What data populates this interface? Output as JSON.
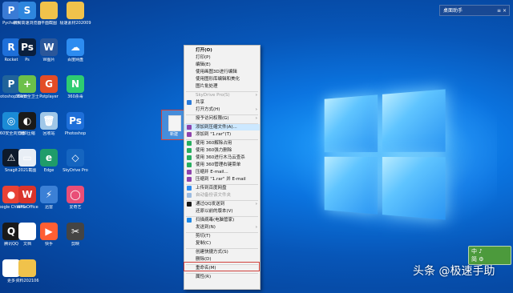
{
  "desktop_icons": [
    {
      "name": "shortcut-1",
      "label": "Pycharm",
      "color": "#3a7bd5",
      "glyph": "P"
    },
    {
      "name": "search-app",
      "label": "搜狗高速浏览器",
      "color": "#2e86de",
      "glyph": "S"
    },
    {
      "name": "folder-1",
      "label": "平面截图",
      "color": "#f0c24b",
      "glyph": ""
    },
    {
      "name": "folder-2",
      "label": "极速素材202009",
      "color": "#f0c24b",
      "glyph": ""
    },
    {
      "name": "shortcut-2",
      "label": "Rocket",
      "color": "#1e6fd9",
      "glyph": "R"
    },
    {
      "name": "photoshop",
      "label": "Ps",
      "color": "#0a1f3d",
      "glyph": "Ps"
    },
    {
      "name": "word",
      "label": "W图片",
      "color": "#2b579a",
      "glyph": "W"
    },
    {
      "name": "baidu-netdisk",
      "label": "百度网盘",
      "color": "#2d8cf0",
      "glyph": "☁"
    },
    {
      "name": "shortcut-3",
      "label": "Photoshop Elements",
      "color": "#20639b",
      "glyph": "P"
    },
    {
      "name": "shortcut-4",
      "label": "360安全卫士",
      "color": "#6cc04a",
      "glyph": "+"
    },
    {
      "name": "shortcut-5",
      "label": "Potplayer",
      "color": "#e34c26",
      "glyph": "G"
    },
    {
      "name": "shortcut-6",
      "label": "360杀毒",
      "color": "#2ecc71",
      "glyph": "N"
    },
    {
      "name": "shortcut-7",
      "label": "360安全浏览器",
      "color": "#1b8bd6",
      "glyph": "◎"
    },
    {
      "name": "shortcut-8",
      "label": "360压缩",
      "color": "#1a1a1a",
      "glyph": "◐"
    },
    {
      "name": "recycle-bin",
      "label": "回收站",
      "color": "#9fc7e8",
      "glyph": "🗑"
    },
    {
      "name": "shortcut-9",
      "label": "Photoshop",
      "color": "#1e6fd9",
      "glyph": "Ps"
    },
    {
      "name": "shortcut-10",
      "label": "Snagit",
      "color": "#0e1a2b",
      "glyph": "⚠"
    },
    {
      "name": "shortcut-11",
      "label": "2021截图",
      "color": "#e8eef5",
      "glyph": "▭"
    },
    {
      "name": "shortcut-12",
      "label": "Edge",
      "color": "#1f9c6a",
      "glyph": "e"
    },
    {
      "name": "shortcut-13",
      "label": "SkyDrive Pro",
      "color": "#1565c0",
      "glyph": "◇"
    },
    {
      "name": "shortcut-14",
      "label": "Google Chrome",
      "color": "#e94235",
      "glyph": "●"
    },
    {
      "name": "shortcut-15",
      "label": "WPS Office",
      "color": "#d9342b",
      "glyph": "W"
    },
    {
      "name": "shortcut-16",
      "label": "迅雷",
      "color": "#3b80d6",
      "glyph": "⚡"
    },
    {
      "name": "shortcut-17",
      "label": "爱奇艺",
      "color": "#e94e77",
      "glyph": "◯"
    },
    {
      "name": "shortcut-18",
      "label": "腾讯QQ",
      "color": "#1a1a1a",
      "glyph": "Q"
    },
    {
      "name": "shortcut-19",
      "label": "文档",
      "color": "#ffffff",
      "glyph": "▤"
    },
    {
      "name": "shortcut-20",
      "label": "快手",
      "color": "#ff5f33",
      "glyph": "▶"
    },
    {
      "name": "shortcut-21",
      "label": "剪映",
      "color": "#444",
      "glyph": "✂"
    },
    {
      "name": "shortcut-22",
      "label": "更多",
      "color": "#ffffff",
      "glyph": "▤"
    },
    {
      "name": "shortcut-23",
      "label": "资料202106",
      "color": "#f0c24b",
      "glyph": ""
    }
  ],
  "selected_file": {
    "label": "新建"
  },
  "context_menu": {
    "items": [
      {
        "label": "打开(O)",
        "bold": true
      },
      {
        "label": "打印(P)"
      },
      {
        "label": "编辑(E)"
      },
      {
        "label": "使用画图3D进行编辑"
      },
      {
        "label": "使用图形库编辑和美化"
      },
      {
        "label": "图片批处理"
      },
      {
        "label": "SkyDrive Pro(S)",
        "disabled": true,
        "submenu": true
      },
      {
        "label": "共享",
        "icon": "#2a7ad8"
      },
      {
        "label": "打开方式(H)",
        "submenu": true
      },
      {
        "label": "授予访问权限(G)",
        "submenu": true
      },
      {
        "label": "添加到压缩文件(A)...",
        "icon": "#8e44ad",
        "highlight": true
      },
      {
        "label": "添加到 \"1.rar\"(T)",
        "icon": "#8e44ad"
      },
      {
        "label": "使用 360解除占用",
        "icon": "#27ae60"
      },
      {
        "label": "使用 360强力删除",
        "icon": "#27ae60"
      },
      {
        "label": "使用 360进行木马云查杀",
        "icon": "#27ae60"
      },
      {
        "label": "使用 360管理右键菜单",
        "icon": "#27ae60"
      },
      {
        "label": "压缩并 E-mail...",
        "icon": "#8e44ad"
      },
      {
        "label": "压缩到 \"1.rar\" 并 E-mail",
        "icon": "#8e44ad"
      },
      {
        "label": "上传到百度网盘",
        "icon": "#2d8cf0"
      },
      {
        "label": "自动备份该文件夹",
        "icon": "#9bbbe0",
        "disabled": true
      },
      {
        "label": "通过QQ发送到",
        "icon": "#1a1a1a",
        "submenu": true
      },
      {
        "label": "还原以前的版本(V)"
      },
      {
        "label": "扫描病毒(电脑管家)",
        "icon": "#1e88e5"
      },
      {
        "label": "发送到(N)",
        "submenu": true
      },
      {
        "label": "剪切(T)"
      },
      {
        "label": "复制(C)"
      },
      {
        "label": "创建快捷方式(S)"
      },
      {
        "label": "删除(D)"
      },
      {
        "label": "重命名(M)"
      },
      {
        "label": "属性(R)"
      }
    ]
  },
  "gadget": {
    "title": "桌面助手",
    "icons": "≡ ×"
  },
  "tray": {
    "line1": "中 ♪",
    "line2": "简 ⚙"
  },
  "watermark": "头条 @极速手助"
}
